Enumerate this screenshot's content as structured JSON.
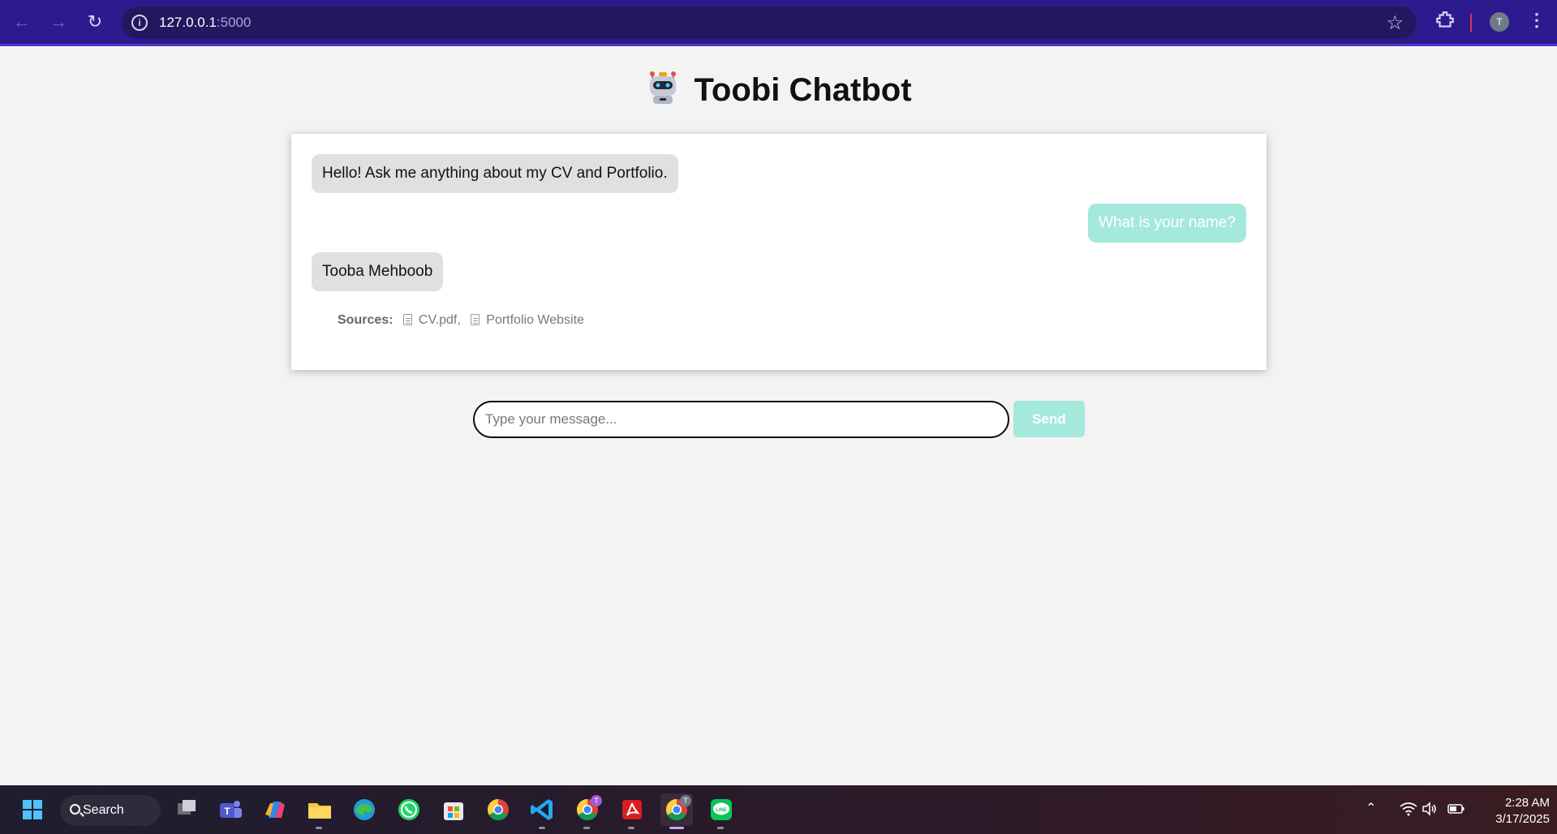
{
  "browser": {
    "url_host": "127.0.0.1",
    "url_port": ":5000",
    "profile_initial": "T"
  },
  "page": {
    "title": "Toobi Chatbot"
  },
  "chat": {
    "messages": [
      {
        "role": "bot",
        "text": "Hello! Ask me anything about my CV and Portfolio."
      },
      {
        "role": "user",
        "text": "What is your name?"
      },
      {
        "role": "bot",
        "text": "Tooba Mehboob"
      }
    ],
    "sources_label": "Sources:",
    "sources": [
      "CV.pdf,",
      "Portfolio Website"
    ]
  },
  "composer": {
    "placeholder": "Type your message...",
    "send_label": "Send"
  },
  "taskbar": {
    "search_label": "Search",
    "time": "2:28 AM",
    "date": "3/17/2025",
    "apps": [
      "task-view",
      "teams",
      "copilot",
      "file-explorer",
      "edge",
      "whatsapp",
      "microsoft-store",
      "chrome",
      "vscode",
      "chrome-profile",
      "acrobat",
      "chrome-active",
      "line"
    ]
  },
  "colors": {
    "chrome_bg": "#2e1a8f",
    "bot_bubble": "#e0e0e0",
    "user_bubble": "#a5e8dc",
    "send_button": "#a5e8dc"
  }
}
